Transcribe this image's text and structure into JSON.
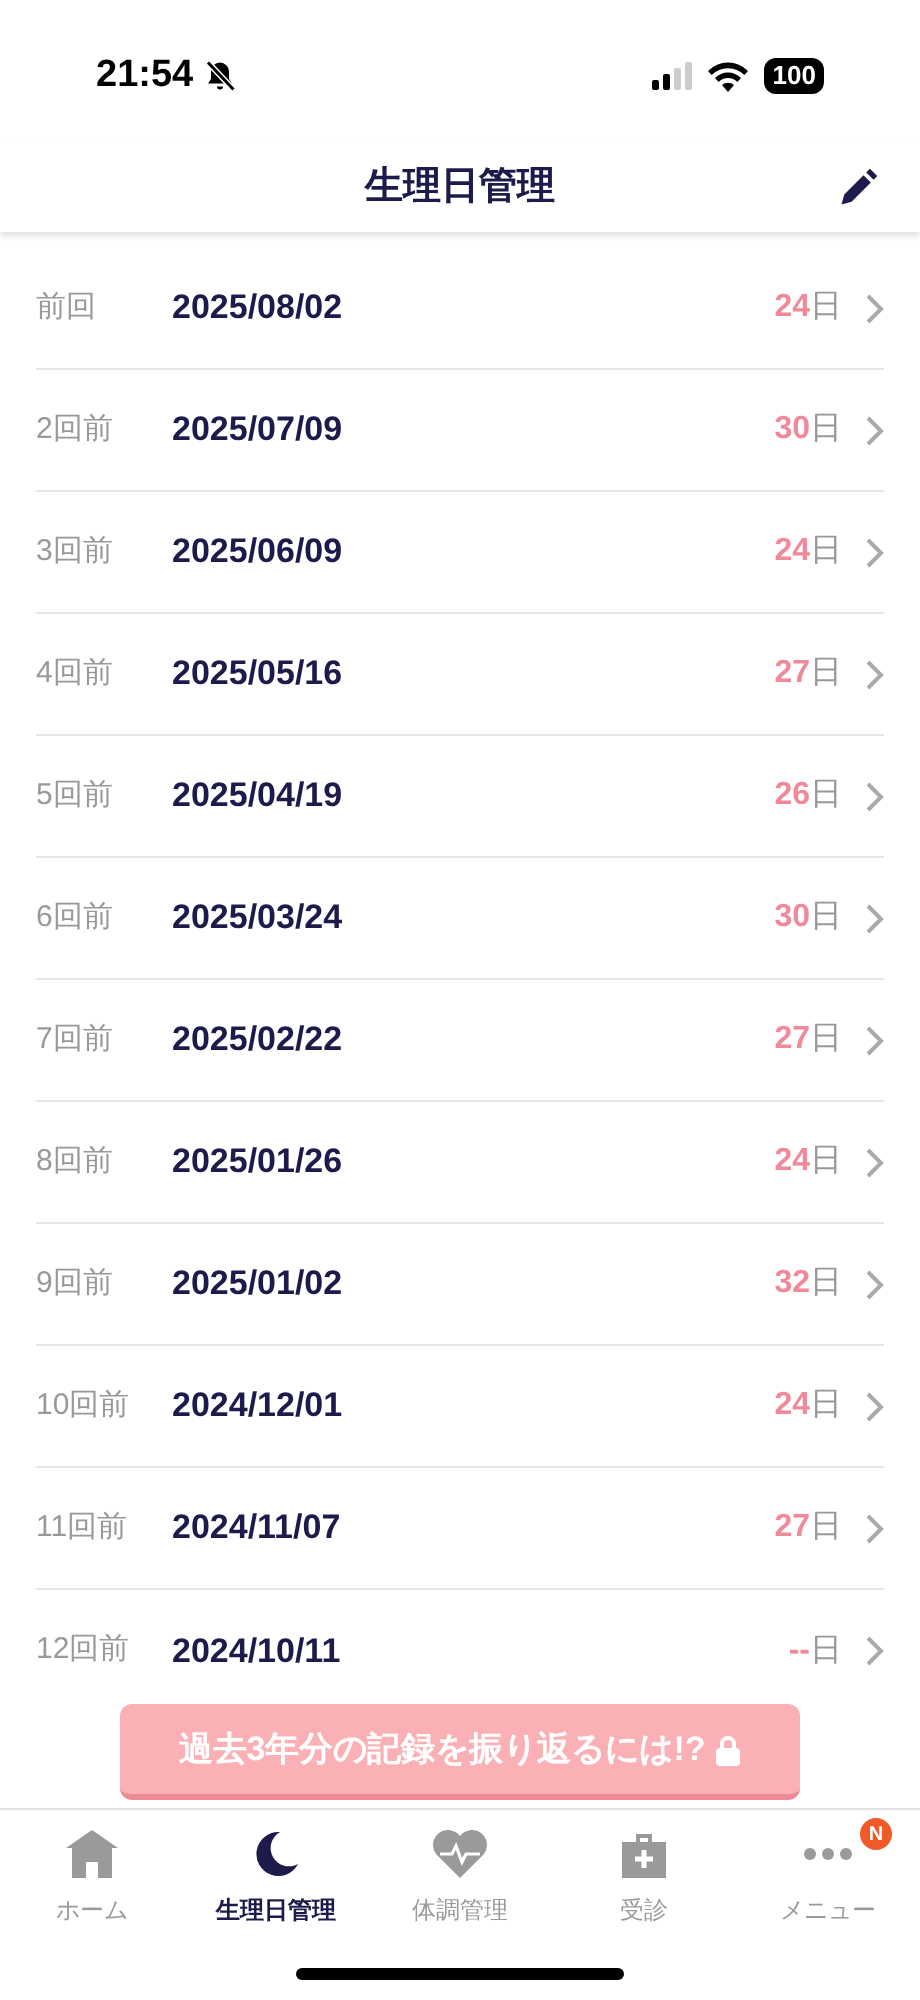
{
  "status_bar": {
    "time": "21:54",
    "silent": true,
    "battery": "100"
  },
  "header": {
    "title": "生理日管理"
  },
  "records": [
    {
      "label": "前回",
      "date": "2025/08/02",
      "days": "24",
      "unit": "日"
    },
    {
      "label": "2回前",
      "date": "2025/07/09",
      "days": "30",
      "unit": "日"
    },
    {
      "label": "3回前",
      "date": "2025/06/09",
      "days": "24",
      "unit": "日"
    },
    {
      "label": "4回前",
      "date": "2025/05/16",
      "days": "27",
      "unit": "日"
    },
    {
      "label": "5回前",
      "date": "2025/04/19",
      "days": "26",
      "unit": "日"
    },
    {
      "label": "6回前",
      "date": "2025/03/24",
      "days": "30",
      "unit": "日"
    },
    {
      "label": "7回前",
      "date": "2025/02/22",
      "days": "27",
      "unit": "日"
    },
    {
      "label": "8回前",
      "date": "2025/01/26",
      "days": "24",
      "unit": "日"
    },
    {
      "label": "9回前",
      "date": "2025/01/02",
      "days": "32",
      "unit": "日"
    },
    {
      "label": "10回前",
      "date": "2024/12/01",
      "days": "24",
      "unit": "日"
    },
    {
      "label": "11回前",
      "date": "2024/11/07",
      "days": "27",
      "unit": "日"
    },
    {
      "label": "12回前",
      "date": "2024/10/11",
      "days": "--",
      "unit": "日"
    }
  ],
  "promo_button": {
    "label": "過去3年分の記録を振り返るには!?",
    "locked": true
  },
  "tab_bar": [
    {
      "kind": "home",
      "label": "ホーム",
      "selected": false
    },
    {
      "kind": "moon",
      "label": "生理日管理",
      "selected": true
    },
    {
      "kind": "heart",
      "label": "体調管理",
      "selected": false
    },
    {
      "kind": "clinic",
      "label": "受診",
      "selected": false
    },
    {
      "kind": "more",
      "label": "メニュー",
      "selected": false,
      "badge": "N"
    }
  ]
}
